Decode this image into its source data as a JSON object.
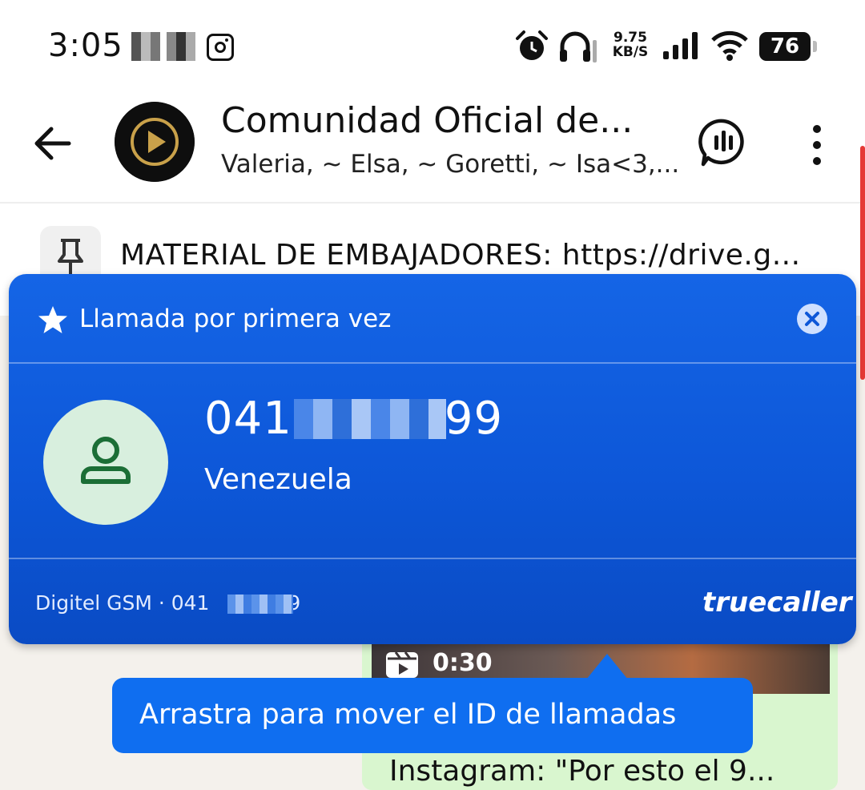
{
  "status_bar": {
    "time": "3:05",
    "speed_value": "9.75",
    "speed_unit": "KB/S",
    "battery": "76",
    "icons": [
      "alarm-icon",
      "headphones-icon",
      "signal-icon",
      "wifi-icon",
      "instagram-icon"
    ]
  },
  "header": {
    "title": "Comunidad Oficial de...",
    "subtitle": "Valeria, ~ Elsa, ~ Goretti, ~ Isa<3,..."
  },
  "pinned": {
    "text": "MATERIAL DE EMBAJADORES: https://drive.g..."
  },
  "message": {
    "video_duration": "0:30",
    "text": "Instagram: \"Por esto el 9..."
  },
  "truecaller": {
    "first_call_label": "Llamada por primera vez",
    "number_prefix": "041",
    "number_suffix": "99",
    "country": "Venezuela",
    "carrier_text": "Digitel GSM · 041",
    "carrier_suffix": "99",
    "brand": "truecaller",
    "colors": {
      "card": "#0d57d8",
      "avatar_bg": "#d8efde",
      "avatar_fg": "#1b6e36"
    }
  },
  "tooltip": {
    "text": "Arrastra para mover el ID de llamadas"
  }
}
